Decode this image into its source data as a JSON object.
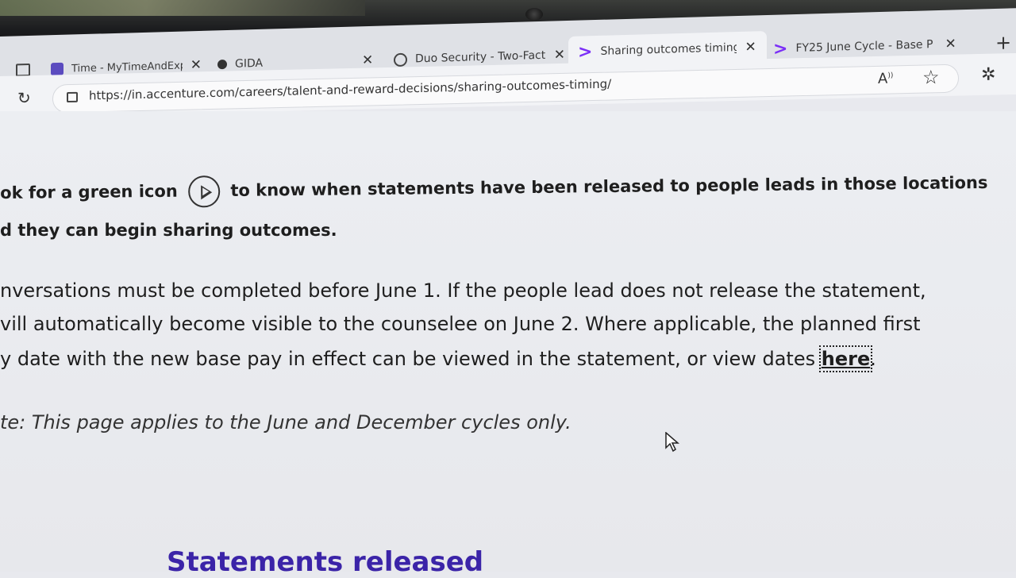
{
  "tabs": [
    {
      "title": "Time - MyTimeAndExpen",
      "favicon": "timesheet-favicon",
      "active": false
    },
    {
      "title": "GIDA",
      "favicon": "gida-favicon",
      "active": false
    },
    {
      "title": "Duo Security - Two-Facto",
      "favicon": "globe-icon",
      "active": false
    },
    {
      "title": "Sharing outcomes timing",
      "favicon": "accenture-chevron",
      "active": true
    },
    {
      "title": "FY25 June Cycle - Base P",
      "favicon": "accenture-chevron",
      "active": false
    }
  ],
  "address_bar": {
    "url": "https://in.accenture.com/careers/talent-and-reward-decisions/sharing-outcomes-timing/"
  },
  "content": {
    "green_icon_line1_a": "ok for a green icon",
    "green_icon_line1_b": "to know when statements have been released to people leads in those locations",
    "green_icon_line2": "d they can begin sharing outcomes.",
    "para_line1": "nversations must be completed before June 1. If the people lead does not release the statement,",
    "para_line2": "vill automatically become visible to the counselee on June 2. Where applicable, the planned first",
    "para_line3": "y date with the new base pay in effect can be viewed in the statement, or view dates",
    "here_link": "here",
    "note": "te: This page applies to the June and December cycles only.",
    "heading": "Statements released"
  },
  "colors": {
    "accent": "#7b2ff7",
    "heading": "#3b24a8"
  }
}
